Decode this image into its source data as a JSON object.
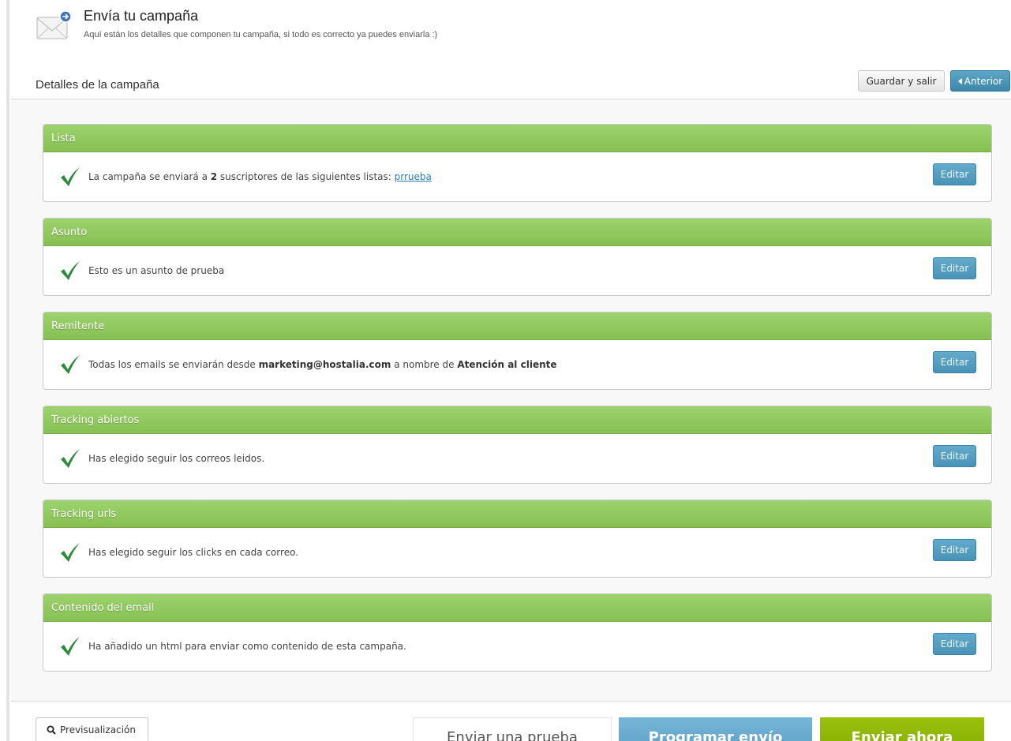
{
  "header": {
    "title": "Envía tu campaña",
    "subtitle": "Aquí están los detalles que componen tu campaña, si todo es correcto ya puedes enviarla :)"
  },
  "details": {
    "title": "Detalles de la campaña",
    "save_label": "Guardar y salir",
    "previous_label": "Anterior"
  },
  "edit_label": "Editar",
  "sections": {
    "lista": {
      "title": "Lista",
      "text_before": "La campaña se enviará a ",
      "count": "2",
      "text_mid": " suscriptores de las siguientes listas: ",
      "link": "prrueba"
    },
    "asunto": {
      "title": "Asunto",
      "text": "Esto es un asunto de prueba"
    },
    "remitente": {
      "title": "Remitente",
      "text_before": "Todas los emails se enviarán desde ",
      "email": "marketing@hostalia.com",
      "text_mid": " a nombre de ",
      "name": "Atención al cliente"
    },
    "tracking_abiertos": {
      "title": "Tracking abiertos",
      "text": "Has elegido seguir los correos leidos."
    },
    "tracking_urls": {
      "title": "Tracking urls",
      "text": "Has elegido seguir los clicks en cada correo."
    },
    "contenido": {
      "title": "Contenido del email",
      "text": "Ha añadido un html para enviar como contenido de esta campaña."
    }
  },
  "footer": {
    "preview_label": "Previsualización",
    "send_test_label": "Enviar una prueba",
    "schedule_label": "Programar envío",
    "send_now_label": "Enviar ahora"
  },
  "icons": {
    "header": "envelope-icon",
    "status": "checkmark-icon",
    "preview": "search-icon",
    "previous": "caret-left-icon"
  },
  "colors": {
    "panel_header": "#8cc65a",
    "edit_button": "#4a93b8",
    "schedule_button": "#6aabd0",
    "send_now_button": "#8fb800",
    "check": "#2e8b3e"
  }
}
